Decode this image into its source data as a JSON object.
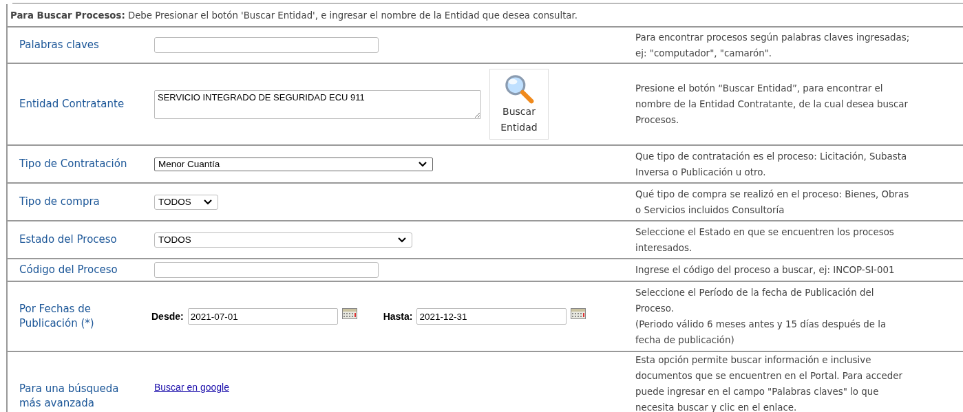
{
  "instructions": "**Para Buscar Procesos:** Debe Presionar el botón 'Buscar Entidad', e ingresar el nombre de la Entidad que desea consultar.",
  "rows": [
    {
      "kind": "text_input",
      "label": "Palabras claves",
      "description_lines": [
        "Para encontrar procesos según palabras claves ingresadas;",
        "ej: \"computador\", \"camarón\"."
      ]
    },
    {
      "kind": "entity",
      "label": "Entidad Contratante",
      "value": "SERVICIO INTEGRADO DE SEGURIDAD ECU 911",
      "button": "Buscar Entidad",
      "description_lines": [
        "Presione el botón “Buscar Entidad”, para encontrar el",
        "nombre de la Entidad Contratante, de la cual desea buscar",
        "Procesos."
      ]
    },
    {
      "kind": "select",
      "label": "Tipo de Contratación",
      "value": "Menor Cuantía",
      "description_lines": [
        "Que tipo de contratación es el proceso: Licitación, Subasta",
        "Inversa o Publicación u otro."
      ]
    },
    {
      "kind": "select",
      "label": "Tipo de compra",
      "value": "TODOS",
      "description_lines": [
        "Qué tipo de compra se realizó en el proceso: Bienes, Obras",
        "o Servicios incluidos Consultoría"
      ]
    },
    {
      "kind": "select",
      "label": "Estado del Proceso",
      "value": "TODOS",
      "description_lines": [
        "Seleccione el Estado en que se encuentren los procesos",
        "interesados."
      ]
    },
    {
      "kind": "text_input",
      "label": "Código del Proceso",
      "description_lines": [
        "Ingrese el código del proceso a buscar, ej: INCOP-SI-001"
      ]
    },
    {
      "kind": "date_range",
      "label": "Por Fechas de Publicación (*)",
      "from_label": "Desde:",
      "from": "2021-07-01",
      "to_label": "Hasta:",
      "to": "2021-12-31",
      "description_lines": [
        "Seleccione el Período de la fecha de Publicación del",
        "Proceso.",
        "(Periodo válido 6 meses antes y 15 días después de la",
        "fecha de publicación)"
      ]
    },
    {
      "kind": "link",
      "label": "Para una búsqueda más avanzada",
      "link": "Buscar en google",
      "description_lines": [
        "Esta opción permite buscar información e inclusive",
        "documentos que se encuentren en el Portal. Para acceder",
        "puede ingresar en el campo \"Palabras claves\" lo que",
        "necesita buscar y clic en el enlace."
      ]
    }
  ]
}
